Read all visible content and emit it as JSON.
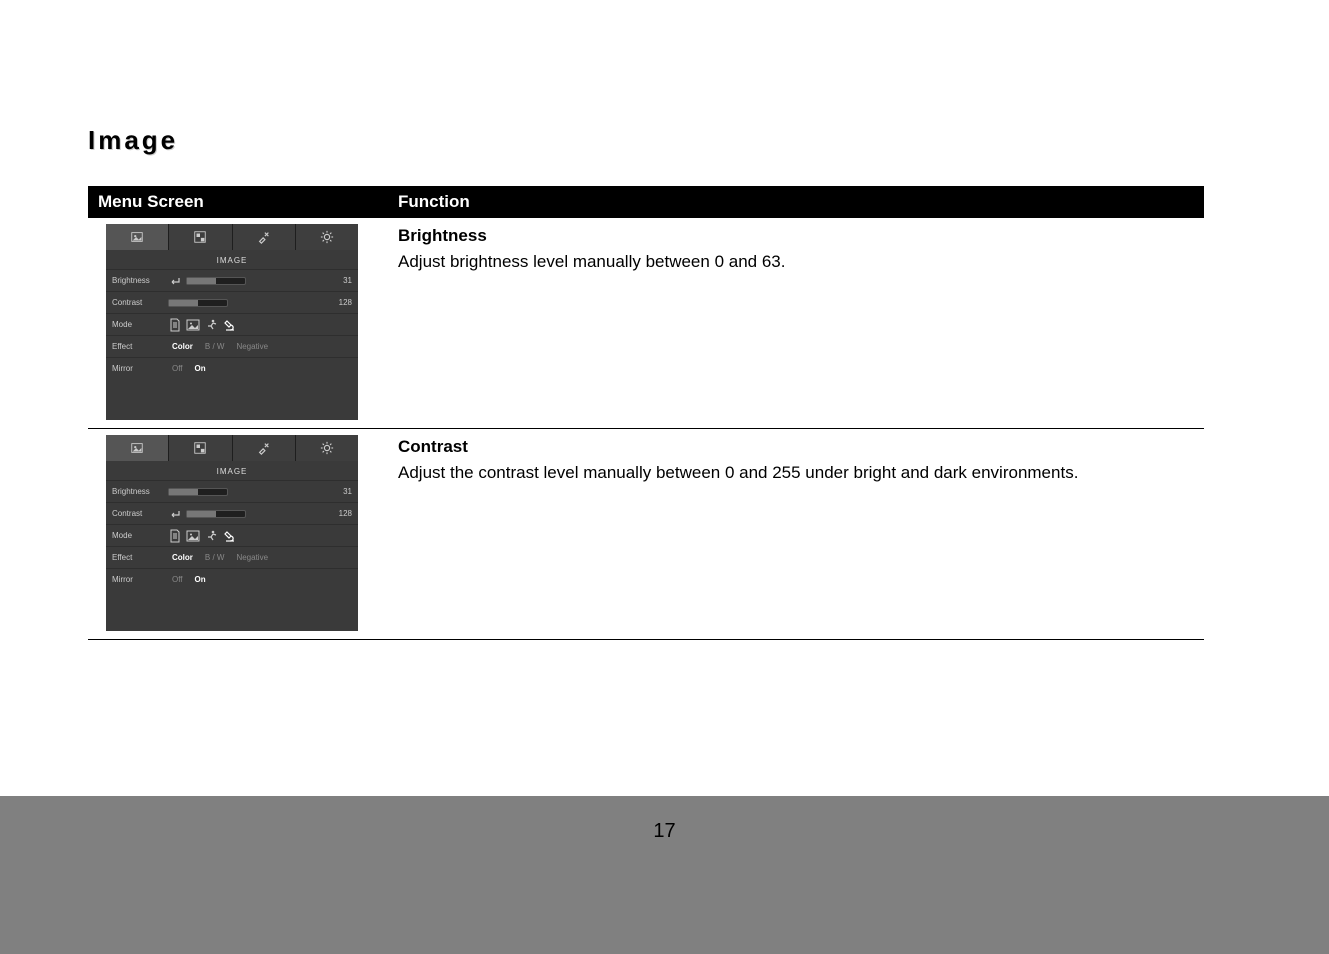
{
  "section_title": "Image",
  "table": {
    "header_menu": "Menu Screen",
    "header_func": "Function"
  },
  "rows": [
    {
      "func_title": "Brightness",
      "func_desc": "Adjust brightness level manually between 0 and 63.",
      "menu": {
        "title": "IMAGE",
        "selected_row": "brightness",
        "brightness": {
          "label": "Brightness",
          "value": "31",
          "fill_pct": 50
        },
        "contrast": {
          "label": "Contrast",
          "value": "128",
          "fill_pct": 50
        },
        "mode": {
          "label": "Mode"
        },
        "effect": {
          "label": "Effect",
          "options": [
            "Color",
            "B / W",
            "Negative"
          ],
          "selected": 0
        },
        "mirror": {
          "label": "Mirror",
          "options": [
            "Off",
            "On"
          ],
          "selected": 1
        }
      }
    },
    {
      "func_title": "Contrast",
      "func_desc": "Adjust the contrast level manually between 0 and 255 under bright and dark environments.",
      "menu": {
        "title": "IMAGE",
        "selected_row": "contrast",
        "brightness": {
          "label": "Brightness",
          "value": "31",
          "fill_pct": 50
        },
        "contrast": {
          "label": "Contrast",
          "value": "128",
          "fill_pct": 50
        },
        "mode": {
          "label": "Mode"
        },
        "effect": {
          "label": "Effect",
          "options": [
            "Color",
            "B / W",
            "Negative"
          ],
          "selected": 0
        },
        "mirror": {
          "label": "Mirror",
          "options": [
            "Off",
            "On"
          ],
          "selected": 1
        }
      }
    }
  ],
  "icons": {
    "tab_image": "image-icon",
    "tab_presentation": "layout-icon",
    "tab_tools": "tools-icon",
    "tab_settings": "gear-icon",
    "mode_text": "document-icon",
    "mode_graphic": "picture-icon",
    "mode_motion": "runner-icon",
    "mode_microscope": "microscope-icon",
    "enter": "enter-icon"
  },
  "page_number": "17"
}
